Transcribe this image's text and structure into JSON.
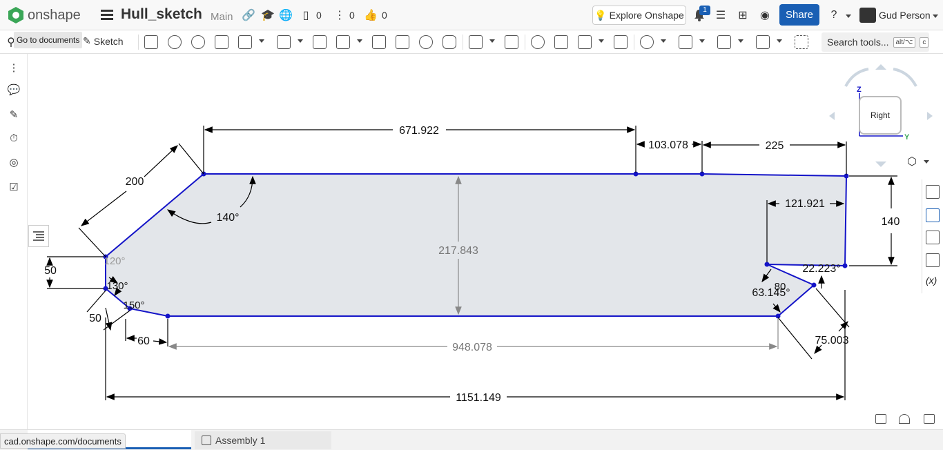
{
  "app": {
    "brand": "onshape",
    "accent": "#1a5fb4"
  },
  "header": {
    "doc_title": "Hull_sketch",
    "branch": "Main",
    "versions_count": "0",
    "branches_count": "0",
    "likes_count": "0",
    "explore_label": "Explore Onshape",
    "notifications_count": "1",
    "share_label": "Share",
    "user_name": "Gud Person"
  },
  "toolbar": {
    "tooltip_go_to_documents": "Go to documents",
    "sketch_label": "Sketch",
    "search_label": "Search tools...",
    "search_kbd_1": "alt/⌥",
    "search_kbd_2": "c"
  },
  "viewcube": {
    "face_label": "Right",
    "axis_z": "Z",
    "axis_y": "Y"
  },
  "sketch": {
    "dimensions": {
      "top_length": "671.922",
      "top_mid": "103.078",
      "top_right": "225",
      "bevel_len": "200",
      "angle_top": "140°",
      "depth": "217.843",
      "angle_120": "120°",
      "angle_130": "130°",
      "angle_150": "150°",
      "left_50": "50",
      "diag_50": "50",
      "bottom_60": "60",
      "bottom_length": "948.078",
      "overall_length": "1151.149",
      "right_height": "140",
      "notch_width": "121.921",
      "notch_angle_22": "22.223°",
      "notch_80": "80",
      "notch_angle_63": "63.145°",
      "notch_75": "75.003"
    }
  },
  "tabs": {
    "assembly_label": "Assembly 1"
  },
  "status_bar": {
    "url": "cad.onshape.com/documents"
  }
}
